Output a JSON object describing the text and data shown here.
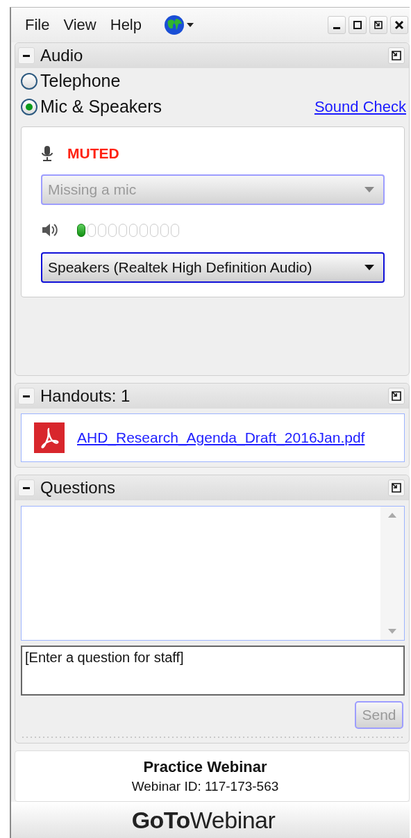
{
  "menu": [
    {
      "label": "File"
    },
    {
      "label": "View"
    },
    {
      "label": "Help"
    }
  ],
  "audio": {
    "title": "Audio",
    "options": [
      {
        "label": "Telephone",
        "selected": false
      },
      {
        "label": "Mic & Speakers",
        "selected": true
      }
    ],
    "sound_check": "Sound Check",
    "mic_status": "MUTED",
    "mic_device": {
      "value": "Missing a mic",
      "disabled": true
    },
    "speaker_device": {
      "value": "Speakers (Realtek High Definition Audio)",
      "disabled": false
    }
  },
  "handouts": {
    "title": "Handouts: 1",
    "files": [
      {
        "name": "AHD_Research_Agenda_Draft_2016Jan.pdf"
      }
    ]
  },
  "questions": {
    "title": "Questions",
    "input": {
      "placeholder": "[Enter a question for staff]"
    },
    "send_button": {
      "label": "Send",
      "disabled": true
    }
  },
  "webinar": {
    "title": "Practice Webinar",
    "id_line": "Webinar ID: 117-173-563"
  },
  "brand": "**GoTo**Webinar"
}
